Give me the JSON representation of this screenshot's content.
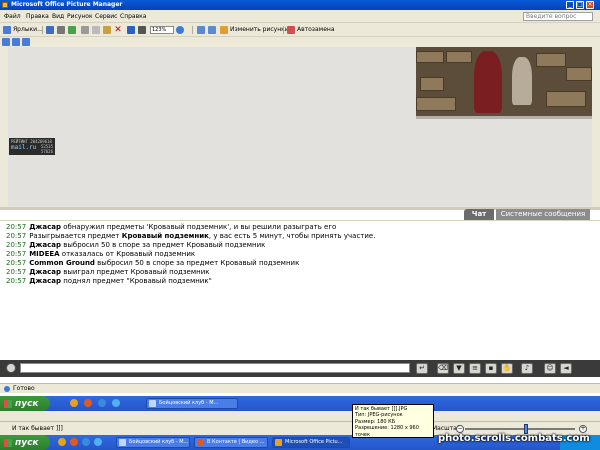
{
  "window": {
    "title": "Microsoft Office Picture Manager"
  },
  "menu": {
    "items": [
      "Файл",
      "Правка",
      "Вид",
      "Рисунок",
      "Сервис",
      "Справка"
    ],
    "help_placeholder": "Введите вопрос"
  },
  "toolbar": {
    "shortcuts_label": "Ярлыки...",
    "zoom_value": "123%",
    "edit_pictures_label": "Изменить рисунки...",
    "autofix_label": "Автозамена"
  },
  "game": {
    "counter_logo": "mail.ru",
    "counter_line1": "РЕЙТИНГ 204269618",
    "counter_line2": "52535",
    "counter_line3": "57626"
  },
  "chat": {
    "tab_chat": "Чат",
    "tab_system": "Системные сообщения",
    "messages": [
      {
        "time": "20:57",
        "actor": "Джасар",
        "text": " обнаружил предметы 'Кровавый подземник', и вы решили разыграть его"
      },
      {
        "time": "20:57",
        "actor": "",
        "pre": "Разыгрывается предмет ",
        "item": "Кровавый подземник",
        "text": ", у вас есть 5 минут, чтобы принять участие."
      },
      {
        "time": "20:57",
        "actor": "Джасар",
        "text": " выбросил 50 в споре за предмет Кровавый подземник"
      },
      {
        "time": "20:57",
        "actor": "MIDEEA",
        "text": " отказалась от Кровавый подземник"
      },
      {
        "time": "20:57",
        "actor": "Common Ground",
        "text": " выбросил 50 в споре за предмет Кровавый подземник"
      },
      {
        "time": "20:57",
        "actor": "Джасар",
        "text": " выиграл предмет Кровавый подземник"
      },
      {
        "time": "20:57",
        "actor": "Джасар",
        "text": " поднял предмет \"Кровавый подземник\""
      }
    ]
  },
  "status": {
    "text": "Готово"
  },
  "taskbar_upper": {
    "start_label": "пуск",
    "tasks": [
      "Бойцовский клуб - М..."
    ]
  },
  "taskbar_lower": {
    "start_label": "пуск",
    "tasks": [
      "Бойцовский клуб - М...",
      "В Контакте | Видео ...",
      "Microsoft Office Pictu..."
    ]
  },
  "bottom_status": {
    "filename": "И так бывает ]]]",
    "zoom_label": "Масштаб:",
    "zoom_level": 0.55
  },
  "tooltip": {
    "lines": [
      "И так бывает ]]].JPG",
      "Тип: JPEG-рисунок",
      "Размер: 180 КБ",
      "Разрешение: 1280 x 960",
      "точек"
    ]
  },
  "watermark": "photo.scrolls.combats.com"
}
